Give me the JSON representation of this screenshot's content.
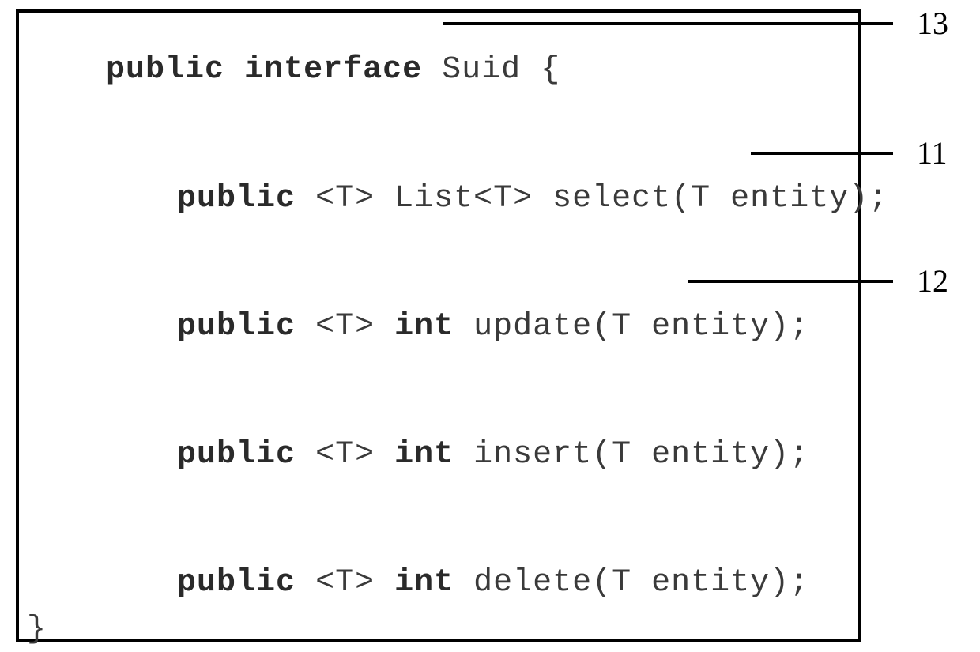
{
  "code": {
    "decl_public": "public",
    "decl_interface": "interface",
    "decl_name": "Suid",
    "decl_brace": "{",
    "select_public": "public",
    "select_generic": "<T>",
    "select_type": "List<T>",
    "select_sig": "select(T entity);",
    "update_public": "public",
    "update_generic": "<T>",
    "update_int": "int",
    "update_sig": "update(T entity);",
    "insert_public": "public",
    "insert_generic": "<T>",
    "insert_int": "int",
    "insert_sig": "insert(T entity);",
    "delete_public": "public",
    "delete_generic": "<T>",
    "delete_int": "int",
    "delete_sig": "delete(T entity);",
    "close_brace": "}"
  },
  "callouts": {
    "c13": "13",
    "c11": "11",
    "c12": "12"
  }
}
